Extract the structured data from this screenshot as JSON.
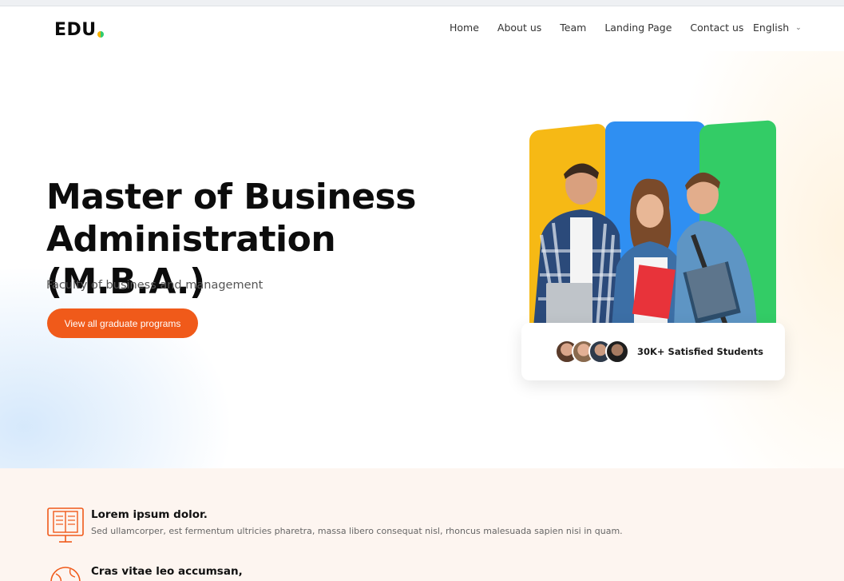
{
  "header": {
    "logo": "EDU",
    "nav": [
      "Home",
      "About us",
      "Team",
      "Landing Page",
      "Contact us"
    ],
    "language": "English"
  },
  "hero": {
    "title": "Master of Business Administration (M.B.A.)",
    "subtitle": "Faculty of business and management",
    "cta_label": "View all graduate programs",
    "stats_text": "30K+ Satisfied Students",
    "panel_colors": [
      "#f6b915",
      "#2f8ff2",
      "#33cc66"
    ],
    "cta_color": "#f05a1a"
  },
  "features": [
    {
      "icon": "book-icon",
      "title": "Lorem ipsum dolor.",
      "description": "Sed ullamcorper, est fermentum ultricies pharetra, massa libero consequat nisl, rhoncus malesuada sapien nisi in quam."
    },
    {
      "icon": "globe-icon",
      "title": "Cras vitae leo accumsan,",
      "description": ""
    }
  ]
}
